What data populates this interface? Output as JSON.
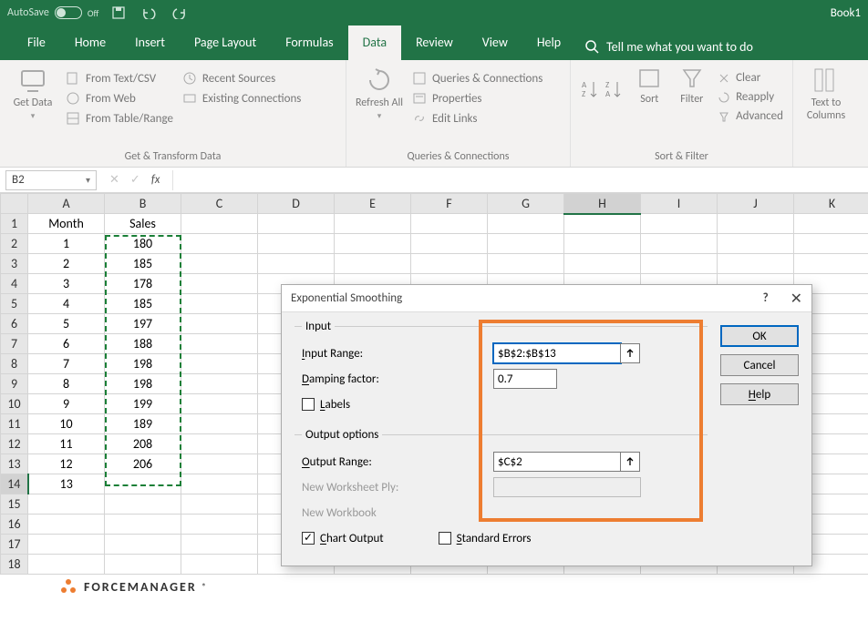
{
  "titlebar": {
    "autosave": "AutoSave",
    "autosave_state": "Off",
    "bookname": "Book1"
  },
  "tabs": [
    "File",
    "Home",
    "Insert",
    "Page Layout",
    "Formulas",
    "Data",
    "Review",
    "View",
    "Help"
  ],
  "active_tab": "Data",
  "tell_me": "Tell me what you want to do",
  "ribbon": {
    "get_data": "Get Data",
    "from_text": "From Text/CSV",
    "from_web": "From Web",
    "from_tbl": "From Table/Range",
    "recent": "Recent Sources",
    "existing": "Existing Connections",
    "group1": "Get & Transform Data",
    "refresh": "Refresh All",
    "queries": "Queries & Connections",
    "properties": "Properties",
    "editlinks": "Edit Links",
    "group2": "Queries & Connections",
    "sort": "Sort",
    "filter": "Filter",
    "clear": "Clear",
    "reapply": "Reapply",
    "advanced": "Advanced",
    "group3": "Sort & Filter",
    "t2c": "Text to Columns"
  },
  "namebox": "B2",
  "sheet": {
    "headers": [
      "A",
      "B",
      "C",
      "D",
      "E",
      "F",
      "G",
      "H",
      "I",
      "J",
      "K"
    ],
    "colA_head": "Month",
    "colB_head": "Sales",
    "rows": [
      "1",
      "2",
      "3",
      "4",
      "5",
      "6",
      "7",
      "8",
      "9",
      "10",
      "11",
      "12",
      "13",
      "14",
      "15",
      "16",
      "17",
      "18"
    ],
    "months": [
      "1",
      "2",
      "3",
      "4",
      "5",
      "6",
      "7",
      "8",
      "9",
      "10",
      "11",
      "12",
      "13"
    ],
    "sales": [
      "180",
      "185",
      "178",
      "185",
      "197",
      "188",
      "198",
      "198",
      "199",
      "189",
      "208",
      "206",
      ""
    ]
  },
  "watermark": "FORCEMANAGER",
  "dialog": {
    "title": "Exponential Smoothing",
    "input_legend": "Input",
    "input_range_lbl": "Input Range:",
    "input_range_val": "$B$2:$B$13",
    "damping_lbl": "Damping factor:",
    "damping_val": "0.7",
    "labels_lbl": "Labels",
    "output_legend": "Output options",
    "output_range_lbl": "Output Range:",
    "output_range_val": "$C$2",
    "new_ws_lbl": "New Worksheet Ply:",
    "new_wb_lbl": "New Workbook",
    "chart_lbl": "Chart Output",
    "stderr_lbl": "Standard Errors",
    "ok": "OK",
    "cancel": "Cancel",
    "help": "Help"
  }
}
